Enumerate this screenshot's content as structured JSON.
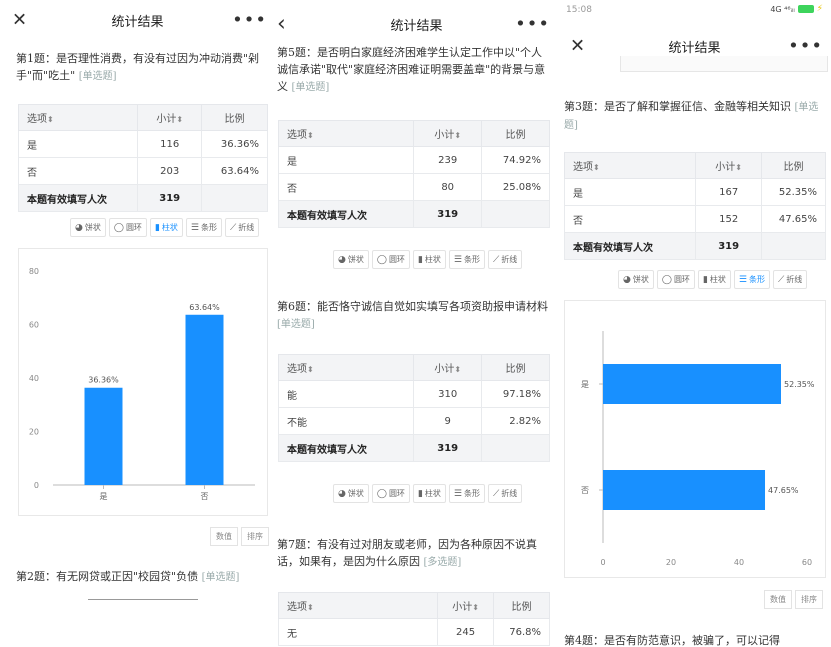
{
  "panels": {
    "p1": {
      "nav": {
        "close": "✕",
        "title": "统计结果",
        "more": "•••"
      },
      "q1": {
        "text": "第1题：是否理性消费，有没有过因为冲动消费\"剁手\"而\"吃土\"",
        "tag": "[单选题]"
      },
      "table": {
        "headers": [
          "选项",
          "小计",
          "比例"
        ],
        "rows": [
          {
            "label": "是",
            "count": "116",
            "pct": "36.36%"
          },
          {
            "label": "否",
            "count": "203",
            "pct": "63.64%"
          }
        ],
        "sum": {
          "label": "本题有效填写人次",
          "count": "319"
        }
      },
      "tabs": [
        "饼状",
        "圆环",
        "柱状",
        "条形",
        "折线"
      ],
      "chart_data": {
        "type": "bar",
        "categories": [
          "是",
          "否"
        ],
        "values": [
          36.36,
          63.64
        ],
        "data_labels": [
          "36.36%",
          "63.64%"
        ],
        "ylim": [
          0,
          80
        ],
        "yticks": [
          "0",
          "20",
          "40",
          "60",
          "80"
        ],
        "bar_color": "#1890ff",
        "grid": false
      },
      "buttons": {
        "data": "数值",
        "sort": "排序"
      },
      "q2": {
        "text": "第2题：有无网贷或正因\"校园贷\"负债",
        "tag": "[单选题]"
      }
    },
    "p2": {
      "nav": {
        "back": "‹",
        "title": "统计结果",
        "more": "•••"
      },
      "q5": {
        "text": "第5题：是否明白家庭经济困难学生认定工作中以\"个人诚信承诺\"取代\"家庭经济困难证明需要盖章\"的背景与意义",
        "tag": "[单选题]"
      },
      "table5": {
        "headers": [
          "选项",
          "小计",
          "比例"
        ],
        "rows": [
          {
            "label": "是",
            "count": "239",
            "pct": "74.92%"
          },
          {
            "label": "否",
            "count": "80",
            "pct": "25.08%"
          }
        ],
        "sum": {
          "label": "本题有效填写人次",
          "count": "319"
        }
      },
      "tabs5": [
        "饼状",
        "圆环",
        "柱状",
        "条形",
        "折线"
      ],
      "q6": {
        "text": "第6题：能否恪守诚信自觉如实填写各项资助报申请材料",
        "tag": "[单选题]"
      },
      "table6": {
        "headers": [
          "选项",
          "小计",
          "比例"
        ],
        "rows": [
          {
            "label": "能",
            "count": "310",
            "pct": "97.18%"
          },
          {
            "label": "不能",
            "count": "9",
            "pct": "2.82%"
          }
        ],
        "sum": {
          "label": "本题有效填写人次",
          "count": "319"
        }
      },
      "tabs6": [
        "饼状",
        "圆环",
        "柱状",
        "条形",
        "折线"
      ],
      "q7": {
        "text": "第7题：有没有过对朋友或老师，因为各种原因不说真话，如果有，是因为什么原因",
        "tag": "[多选题]"
      },
      "table7": {
        "headers": [
          "选项",
          "小计",
          "比例"
        ],
        "rows": [
          {
            "label": "无",
            "count": "245",
            "pct": "76.8%"
          }
        ]
      }
    },
    "p3": {
      "status": {
        "time": "15:08",
        "signal": "4G ⁴⁶ᵢₗₗ",
        "bolt": "⚡"
      },
      "nav": {
        "close": "✕",
        "title": "统计结果",
        "more": "•••"
      },
      "q3": {
        "text": "第3题：是否了解和掌握征信、金融等相关知识",
        "tag": "[单选题]"
      },
      "table": {
        "headers": [
          "选项",
          "小计",
          "比例"
        ],
        "rows": [
          {
            "label": "是",
            "count": "167",
            "pct": "52.35%"
          },
          {
            "label": "否",
            "count": "152",
            "pct": "47.65%"
          }
        ],
        "sum": {
          "label": "本题有效填写人次",
          "count": "319"
        }
      },
      "tabs": [
        "饼状",
        "圆环",
        "柱状",
        "条形",
        "折线"
      ],
      "chart_data": {
        "type": "bar",
        "orientation": "horizontal",
        "categories": [
          "是",
          "否"
        ],
        "values": [
          52.35,
          47.65
        ],
        "data_labels": [
          "52.35%",
          "47.65%"
        ],
        "xlim": [
          0,
          60
        ],
        "xticks": [
          "0",
          "20",
          "40",
          "60"
        ],
        "bar_color": "#1890ff",
        "grid": false
      },
      "buttons": {
        "data": "数值",
        "sort": "排序"
      },
      "q4": {
        "text": "第4题：是否有防范意识，被骗了，可以记得"
      }
    }
  }
}
